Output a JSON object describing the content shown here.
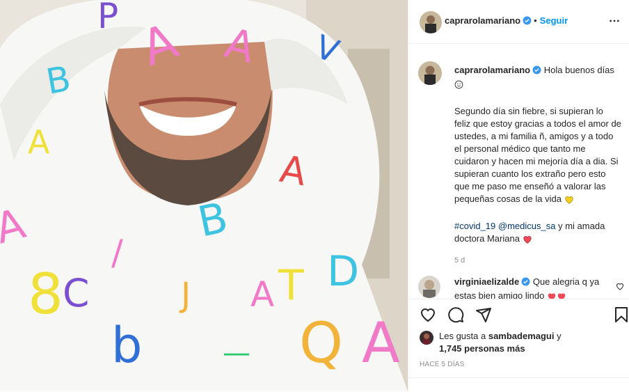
{
  "post": {
    "author": "caprarolamariano",
    "follow_label": "Seguir",
    "dot": "•",
    "caption_greeting": "Hola buenos días",
    "caption_body": "Segundo día sin fiebre, si supieran lo feliz que estoy gracias a todos el amor de ustedes, a mi familia ñ, amigos y a todo el personal médico que tanto me cuidaron y hacen mi mejoría día a dia. Si supieran cuanto los extraño pero esto que me paso me enseñó a valorar las pequeñas cosas de la vida",
    "hashtag": "#covid_19",
    "mention": "@medicus_sa",
    "caption_tail": "y mi amada doctora Mariana",
    "age": "5 d"
  },
  "comment": {
    "author": "virginiaelizalde",
    "text": "Que alegria q ya estas bien amigo lindo"
  },
  "likes": {
    "prefix": "Les gusta a",
    "user": "sambademagui",
    "joiner": "y",
    "count_text": "1,745 personas más"
  },
  "timestamp": "HACE 5 DÍAS",
  "icons": {
    "more": "more-horizontal-icon",
    "verified": "verified-badge-icon",
    "like": "heart-outline-icon",
    "comment": "comment-bubble-icon",
    "share": "paper-plane-icon",
    "save": "bookmark-icon"
  },
  "colors": {
    "accent": "#0095f6",
    "verified": "#3897f0",
    "link": "#00376b",
    "muted": "#8e8e8e",
    "heart": "#ed4956",
    "yellow_heart": "#f5d01b"
  }
}
